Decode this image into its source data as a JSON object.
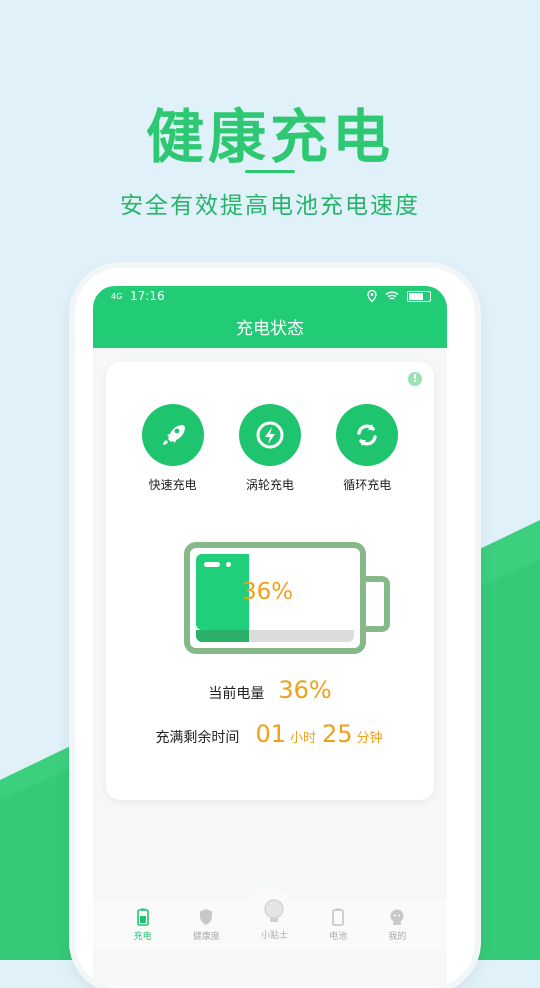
{
  "hero": {
    "title": "健康充电",
    "subtitle": "安全有效提高电池充电速度"
  },
  "status": {
    "signal": "4G",
    "time": "17:16"
  },
  "nav": {
    "title": "充电状态"
  },
  "card": {
    "info_icon": "!",
    "modes": [
      {
        "label": "快速充电",
        "icon": "rocket-icon"
      },
      {
        "label": "涡轮充电",
        "icon": "bolt-icon"
      },
      {
        "label": "循环充电",
        "icon": "refresh-icon"
      }
    ],
    "battery_level": 36,
    "battery_percent_text": "36%",
    "current_label": "当前电量",
    "current_value": "36%",
    "remaining_label": "充满剩余时间",
    "remaining_hours": "01",
    "hours_unit": "小时",
    "remaining_minutes": "25",
    "minutes_unit": "分钟"
  },
  "tabs": [
    {
      "label": "充电",
      "icon": "battery-charge-icon",
      "active": true
    },
    {
      "label": "健康度",
      "icon": "shield-icon",
      "active": false
    },
    {
      "label": "小贴士",
      "icon": "bulb-icon",
      "active": false
    },
    {
      "label": "电池",
      "icon": "battery-icon",
      "active": false
    },
    {
      "label": "我的",
      "icon": "user-icon",
      "active": false
    }
  ],
  "colors": {
    "accent": "#22cc77",
    "highlight": "#f0a019",
    "background": "#e0f1fa"
  }
}
